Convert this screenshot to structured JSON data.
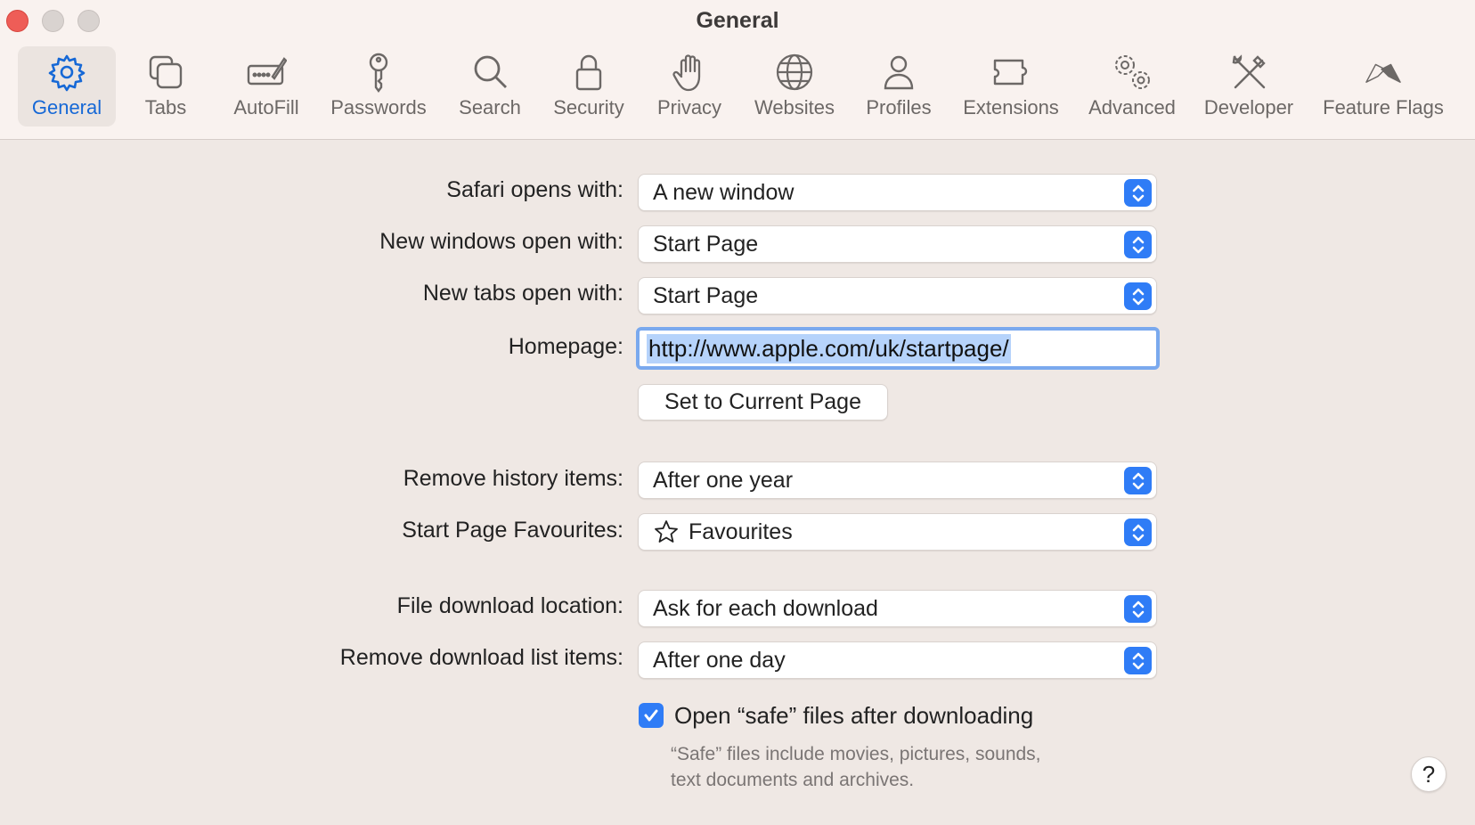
{
  "window": {
    "title": "General"
  },
  "tabs": [
    {
      "label": "General",
      "icon": "gear-icon",
      "active": true
    },
    {
      "label": "Tabs",
      "icon": "tabs-icon"
    },
    {
      "label": "AutoFill",
      "icon": "autofill-pen-icon"
    },
    {
      "label": "Passwords",
      "icon": "key-icon"
    },
    {
      "label": "Search",
      "icon": "magnifier-icon"
    },
    {
      "label": "Security",
      "icon": "lock-icon"
    },
    {
      "label": "Privacy",
      "icon": "hand-icon"
    },
    {
      "label": "Websites",
      "icon": "globe-icon"
    },
    {
      "label": "Profiles",
      "icon": "person-icon"
    },
    {
      "label": "Extensions",
      "icon": "puzzle-icon"
    },
    {
      "label": "Advanced",
      "icon": "gears-icon"
    },
    {
      "label": "Developer",
      "icon": "tools-icon"
    },
    {
      "label": "Feature Flags",
      "icon": "flags-icon"
    }
  ],
  "settings": {
    "safari_opens_with": {
      "label": "Safari opens with:",
      "value": "A new window"
    },
    "new_windows": {
      "label": "New windows open with:",
      "value": "Start Page"
    },
    "new_tabs": {
      "label": "New tabs open with:",
      "value": "Start Page"
    },
    "homepage": {
      "label": "Homepage:",
      "value": "http://www.apple.com/uk/startpage/"
    },
    "set_current_label": "Set to Current Page",
    "remove_history": {
      "label": "Remove history items:",
      "value": "After one year"
    },
    "favourites": {
      "label": "Start Page Favourites:",
      "value": "Favourites"
    },
    "download_location": {
      "label": "File download location:",
      "value": "Ask for each download"
    },
    "remove_downloads": {
      "label": "Remove download list items:",
      "value": "After one day"
    },
    "open_safe": {
      "label": "Open “safe” files after downloading",
      "checked": true
    },
    "hint_line1": "“Safe” files include movies, pictures, sounds,",
    "hint_line2": "text documents and archives."
  },
  "help_label": "?",
  "colors": {
    "accent": "#2f7cf6",
    "close": "#ee5d57",
    "active_tab_text": "#1668d6"
  }
}
